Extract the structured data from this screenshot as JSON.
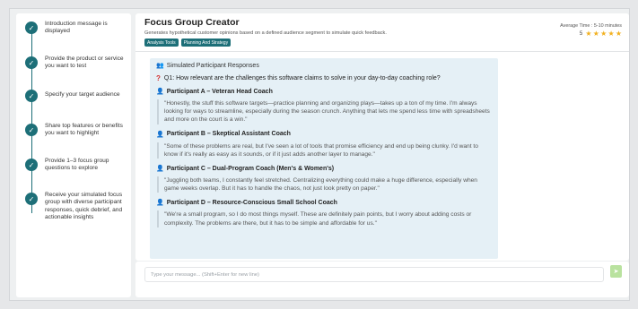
{
  "steps": [
    {
      "label": "Introduction message is displayed"
    },
    {
      "label": "Provide the product or service you want to test"
    },
    {
      "label": "Specify your target audience"
    },
    {
      "label": "Share top features or benefits you want to highlight"
    },
    {
      "label": "Provide 1–3 focus group questions to explore"
    },
    {
      "label": "Receive your simulated focus group with diverse participant responses, quick debrief, and actionable insights"
    }
  ],
  "header": {
    "title": "Focus Group Creator",
    "subtitle": "Generates hypothetical customer opinions based on a defined audience segment to simulate quick feedback.",
    "tags": [
      "Analysis Tools",
      "Planning And Strategy"
    ],
    "avg_time": "Average Time : 5-10 minutes",
    "rating": "5"
  },
  "responses": {
    "heading": "Simulated Participant Responses",
    "question": "Q1: How relevant are the challenges this software claims to solve in your day-to-day coaching role?",
    "participants": [
      {
        "name": "Participant A – Veteran Head Coach",
        "quote": "\"Honestly, the stuff this software targets—practice planning and organizing plays—takes up a ton of my time. I'm always looking for ways to streamline, especially during the season crunch. Anything that lets me spend less time with spreadsheets and more on the court is a win.\""
      },
      {
        "name": "Participant B – Skeptical Assistant Coach",
        "quote": "\"Some of these problems are real, but I've seen a lot of tools that promise efficiency and end up being clunky. I'd want to know if it's really as easy as it sounds, or if it just adds another layer to manage.\""
      },
      {
        "name": "Participant C – Dual-Program Coach (Men's & Women's)",
        "quote": "\"Juggling both teams, I constantly feel stretched. Centralizing everything could make a huge difference, especially when game weeks overlap. But it has to handle the chaos, not just look pretty on paper.\""
      },
      {
        "name": "Participant D – Resource-Conscious Small School Coach",
        "quote": "\"We're a small program, so I do most things myself. These are definitely pain points, but I worry about adding costs or complexity. The problems are there, but it has to be simple and affordable for us.\""
      }
    ]
  },
  "input": {
    "placeholder": "Type your message... (Shift+Enter for new line)"
  },
  "colors": {
    "accent": "#1d6f78",
    "star": "#f2b01e",
    "panel": "#e5f0f6"
  }
}
